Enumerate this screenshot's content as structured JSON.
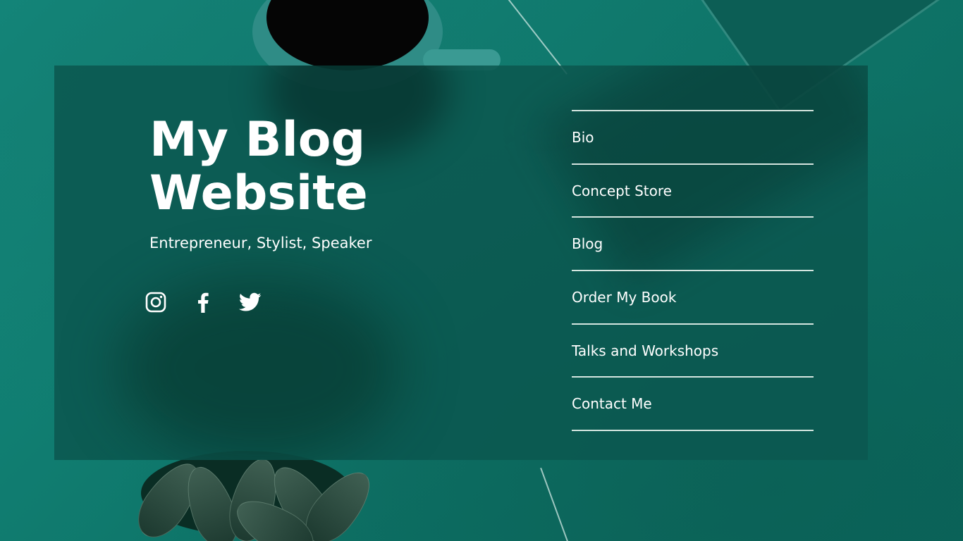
{
  "site": {
    "title_line1": "My Blog",
    "title_line2": "Website",
    "subtitle": "Entrepreneur, Stylist, Speaker"
  },
  "socials": [
    {
      "icon": "instagram-icon"
    },
    {
      "icon": "facebook-icon"
    },
    {
      "icon": "twitter-icon"
    }
  ],
  "nav": {
    "items": [
      {
        "label": "Bio"
      },
      {
        "label": "Concept Store"
      },
      {
        "label": "Blog"
      },
      {
        "label": "Order My Book"
      },
      {
        "label": "Talks and Workshops"
      },
      {
        "label": "Contact Me"
      }
    ]
  },
  "colors": {
    "background": "#0f7c70",
    "panel": "#0b5850",
    "text": "#ffffff"
  }
}
